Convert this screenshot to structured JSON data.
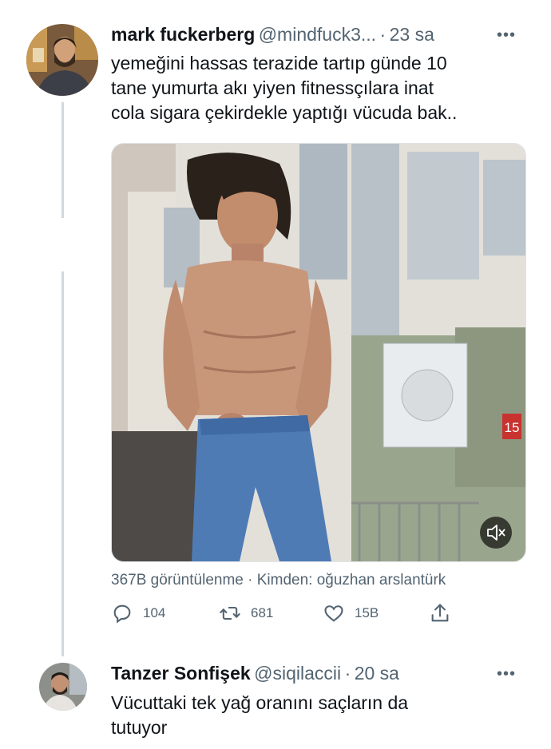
{
  "tweet": {
    "author_name": "mark fuckerberg",
    "handle": "@mindfuck3...",
    "separator": "·",
    "time": "23 sa",
    "more": "•••",
    "text_lines": [
      "yemeğini hassas terazide tartıp günde 10",
      "tane yumurta akı yiyen fitnessçılara inat",
      "cola sigara çekirdekle yaptığı vücuda bak.."
    ],
    "media": {
      "kind": "video",
      "wall_sign": "15",
      "mute_icon": "speaker-muted-icon"
    },
    "views_line": "367B görüntülenme · Kimden: oğuzhan arslantürk",
    "actions": {
      "reply_count": "104",
      "retweet_count": "681",
      "like_count": "15B"
    }
  },
  "reply": {
    "author_name": "Tanzer Sonfişek",
    "handle": "@siqilaccii",
    "separator": "·",
    "time": "20 sa",
    "more": "•••",
    "text_lines": [
      "Vücuttaki tek yağ oranını saçların da",
      "tutuyor"
    ]
  },
  "colors": {
    "text_primary": "#0f1419",
    "text_secondary": "#536471",
    "thread_line": "#cfd9de"
  }
}
